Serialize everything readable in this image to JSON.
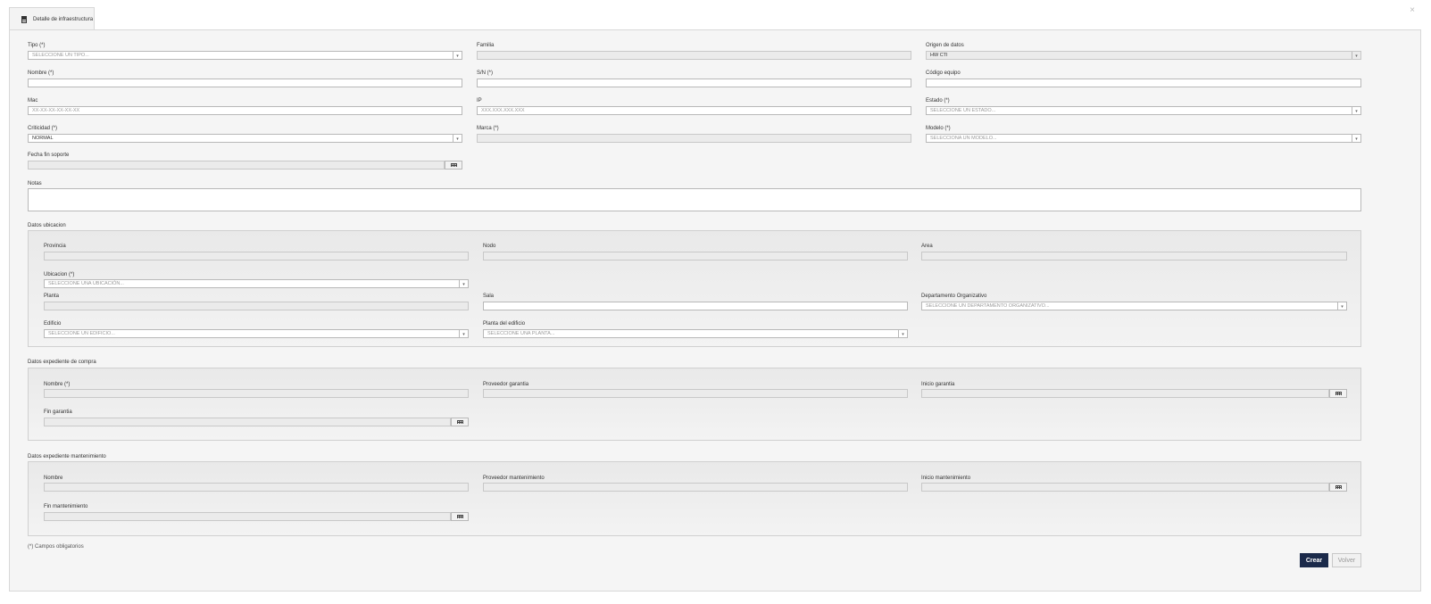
{
  "tab": {
    "title": "Detalle de infraestructura"
  },
  "close_label": "×",
  "main": {
    "tipo": {
      "label": "Tipo (*)",
      "placeholder": "SELECCIONE UN TIPO..."
    },
    "familia": {
      "label": "Familia"
    },
    "origen": {
      "label": "Origen de datos",
      "value": "HW CTI"
    },
    "nombre": {
      "label": "Nombre (*)"
    },
    "sn": {
      "label": "S/N (*)"
    },
    "codigo": {
      "label": "Código equipo"
    },
    "mac": {
      "label": "Mac",
      "placeholder": "XX-XX-XX-XX-XX-XX"
    },
    "ip": {
      "label": "IP",
      "placeholder": "XXX.XXX.XXX.XXX"
    },
    "estado": {
      "label": "Estado (*)",
      "placeholder": "SELECCIONE UN ESTADO..."
    },
    "criticidad": {
      "label": "Criticidad (*)",
      "value": "NORMAL"
    },
    "marca": {
      "label": "Marca (*)"
    },
    "modelo": {
      "label": "Modelo (*)",
      "placeholder": "SELECCIONA UN MODELO..."
    },
    "fecha_fin": {
      "label": "Fecha fin soporte"
    },
    "notas": {
      "label": "Notas"
    }
  },
  "ubicacion": {
    "title": "Datos ubicacion",
    "provincia": {
      "label": "Provincia"
    },
    "nodo": {
      "label": "Nodo"
    },
    "area": {
      "label": "Area"
    },
    "ubicacion": {
      "label": "Ubicacion (*)",
      "placeholder": "SELECCIONE UNA UBICACIÓN..."
    },
    "planta": {
      "label": "Planta"
    },
    "sala": {
      "label": "Sala"
    },
    "departamento": {
      "label": "Departamento Organizativo",
      "placeholder": "SELECCIONE UN DEPARTAMENTO ORGANIZATIVO..."
    },
    "edificio": {
      "label": "Edificio",
      "placeholder": "SELECCIONE UN EDIFICIO..."
    },
    "planta_edificio": {
      "label": "Planta del edificio",
      "placeholder": "SELECCIONE UNA PLANTA..."
    }
  },
  "compra": {
    "title": "Datos expediente de compra",
    "nombre": {
      "label": "Nombre (*)"
    },
    "proveedor": {
      "label": "Proveedor garantia"
    },
    "inicio": {
      "label": "Inicio garantia"
    },
    "fin": {
      "label": "Fin garantia"
    }
  },
  "mantenimiento": {
    "title": "Datos expediente mantenimiento",
    "nombre": {
      "label": "Nombre"
    },
    "proveedor": {
      "label": "Proveedor mantenimiento"
    },
    "inicio": {
      "label": "Inicio mantenimiento"
    },
    "fin": {
      "label": "Fin mantenimiento"
    }
  },
  "footer": {
    "required_note": "(*) Campos obligatorios",
    "crear_label": "Crear",
    "volver_label": "Volver"
  },
  "colors": {
    "primary": "#1b2a4a",
    "panel_bg": "#f5f5f5",
    "border": "#d8d8d8"
  },
  "icons": {
    "tab": "document-icon",
    "close": "close-icon",
    "calendar": "calendar-icon",
    "select": "chevron-down-icon"
  }
}
